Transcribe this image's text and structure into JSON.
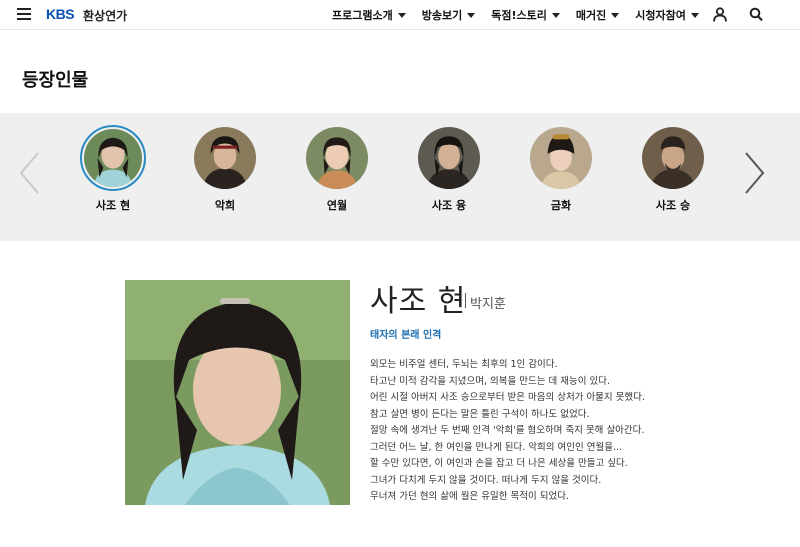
{
  "header": {
    "brand": "KBS",
    "program": "환상연가",
    "menu": [
      "프로그램소개",
      "방송보기",
      "독점!스토리",
      "매거진",
      "시청자참여"
    ],
    "icons": [
      "menu-icon",
      "user-icon",
      "search-icon"
    ]
  },
  "page_title": "등장인물",
  "characters": [
    "사조 현",
    "악희",
    "연월",
    "사조 융",
    "금화",
    "사조 승"
  ],
  "active_character": 0,
  "detail": {
    "name": "사조 현",
    "actor": "박지훈",
    "subtitle": "태자의 본래 인격",
    "bio": [
      "외모는 비주얼 센터, 두뇌는 최후의 1인 감이다.",
      "타고난 미적 감각을 지녔으며, 의복을 만드는 데 재능이 있다.",
      "어린 시절 아버지 사조 승으로부터 받은 마음의 상처가 아물지 못했다.",
      "참고 살면 병이 든다는 말은 틀린 구석이 하나도 없었다.",
      "절망 속에 생겨난 두 번째 인격 '악희'를 혐오하며 죽지 못해 살아간다.",
      "그러던 어느 날, 한 여인을 만나게 된다. 악희의 여인인 연월을...",
      "할 수만 있다면, 이 여인과 손을 잡고 더 나은 세상을 만들고 싶다.",
      "그녀가 다치게 두지 않을 것이다. 떠나게 두지 않을 것이다.",
      "무너져 가던 현의 삶에 월은 유일한 목적이 되었다."
    ]
  },
  "colors": {
    "brand": "#0a50b4",
    "accent": "#2a8ac4",
    "subtitle": "#1b6fb0",
    "band": "#efefef"
  }
}
